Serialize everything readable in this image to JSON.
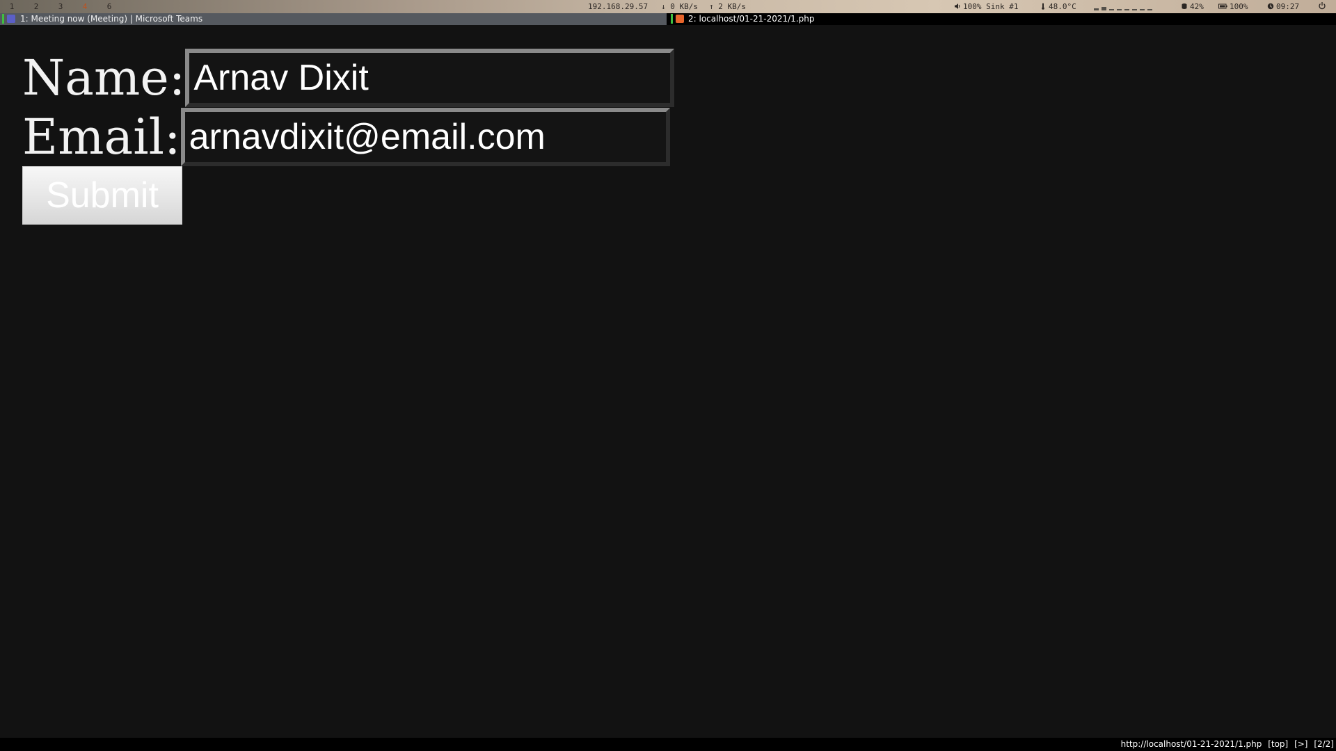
{
  "statusbar": {
    "workspaces": [
      "1",
      "2",
      "3",
      "4",
      "6"
    ],
    "focused_workspace": "4",
    "ip": "192.168.29.57",
    "net_down": "↓ 0 KB/s",
    "net_up": "↑ 2 KB/s",
    "volume": "100% Sink #1",
    "temperature": "48.0°C",
    "disk": "42%",
    "battery": "100%",
    "time": "09:27"
  },
  "windows": {
    "tab1_title": "1: Meeting now (Meeting) | Microsoft Teams",
    "tab2_title": "2: localhost/01-21-2021/1.php"
  },
  "form": {
    "name_label": "Name:",
    "name_value": "Arnav Dixit",
    "email_label": "Email:",
    "email_value": "arnavdixit@email.com",
    "submit_label": "Submit"
  },
  "bottombar": {
    "url": "http://localhost/01-21-2021/1.php",
    "scroll": "[top]",
    "mode": "[>]",
    "tab_index": "[2/2]"
  },
  "colors": {
    "background": "#121212",
    "focused_workspace": "#c0521e",
    "tab1_marker": "#3fbf3f",
    "tab2_marker": "#3fbf3f",
    "teams_icon": "#5b5fc7",
    "page_icon": "#e8652b"
  },
  "icons": {
    "volume": "speaker-icon",
    "temperature": "thermometer-icon",
    "disk": "disk-icon",
    "battery": "battery-icon",
    "time": "clock-icon",
    "power": "power-icon"
  }
}
